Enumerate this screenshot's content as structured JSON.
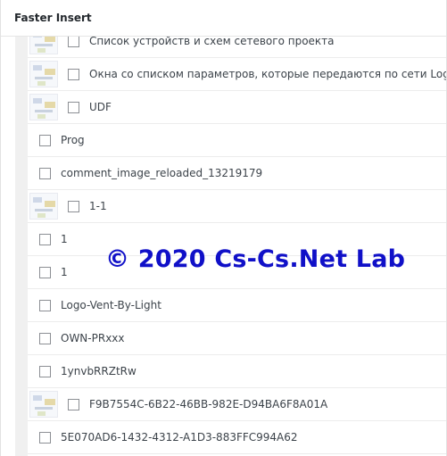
{
  "panel": {
    "title": "Faster Insert"
  },
  "items": [
    {
      "label": "Список устройств и схем сетевого проекта",
      "thumb": true
    },
    {
      "label": "Окна со списком параметров, которые передаются по сети Logo",
      "thumb": true
    },
    {
      "label": "UDF",
      "thumb": true
    },
    {
      "label": "Prog",
      "thumb": false
    },
    {
      "label": "comment_image_reloaded_13219179",
      "thumb": false
    },
    {
      "label": "1-1",
      "thumb": true
    },
    {
      "label": "1",
      "thumb": false
    },
    {
      "label": "1",
      "thumb": false
    },
    {
      "label": "Logo-Vent-By-Light",
      "thumb": false
    },
    {
      "label": "OWN-PRxxx",
      "thumb": false
    },
    {
      "label": "1ynvbRRZtRw",
      "thumb": false
    },
    {
      "label": "F9B7554C-6B22-46BB-982E-D94BA6F8A01A",
      "thumb": true
    },
    {
      "label": "5E070AD6-1432-4312-A1D3-883FFC994A62",
      "thumb": false
    }
  ],
  "watermark": "© 2020 Cs-Cs.Net Lab"
}
